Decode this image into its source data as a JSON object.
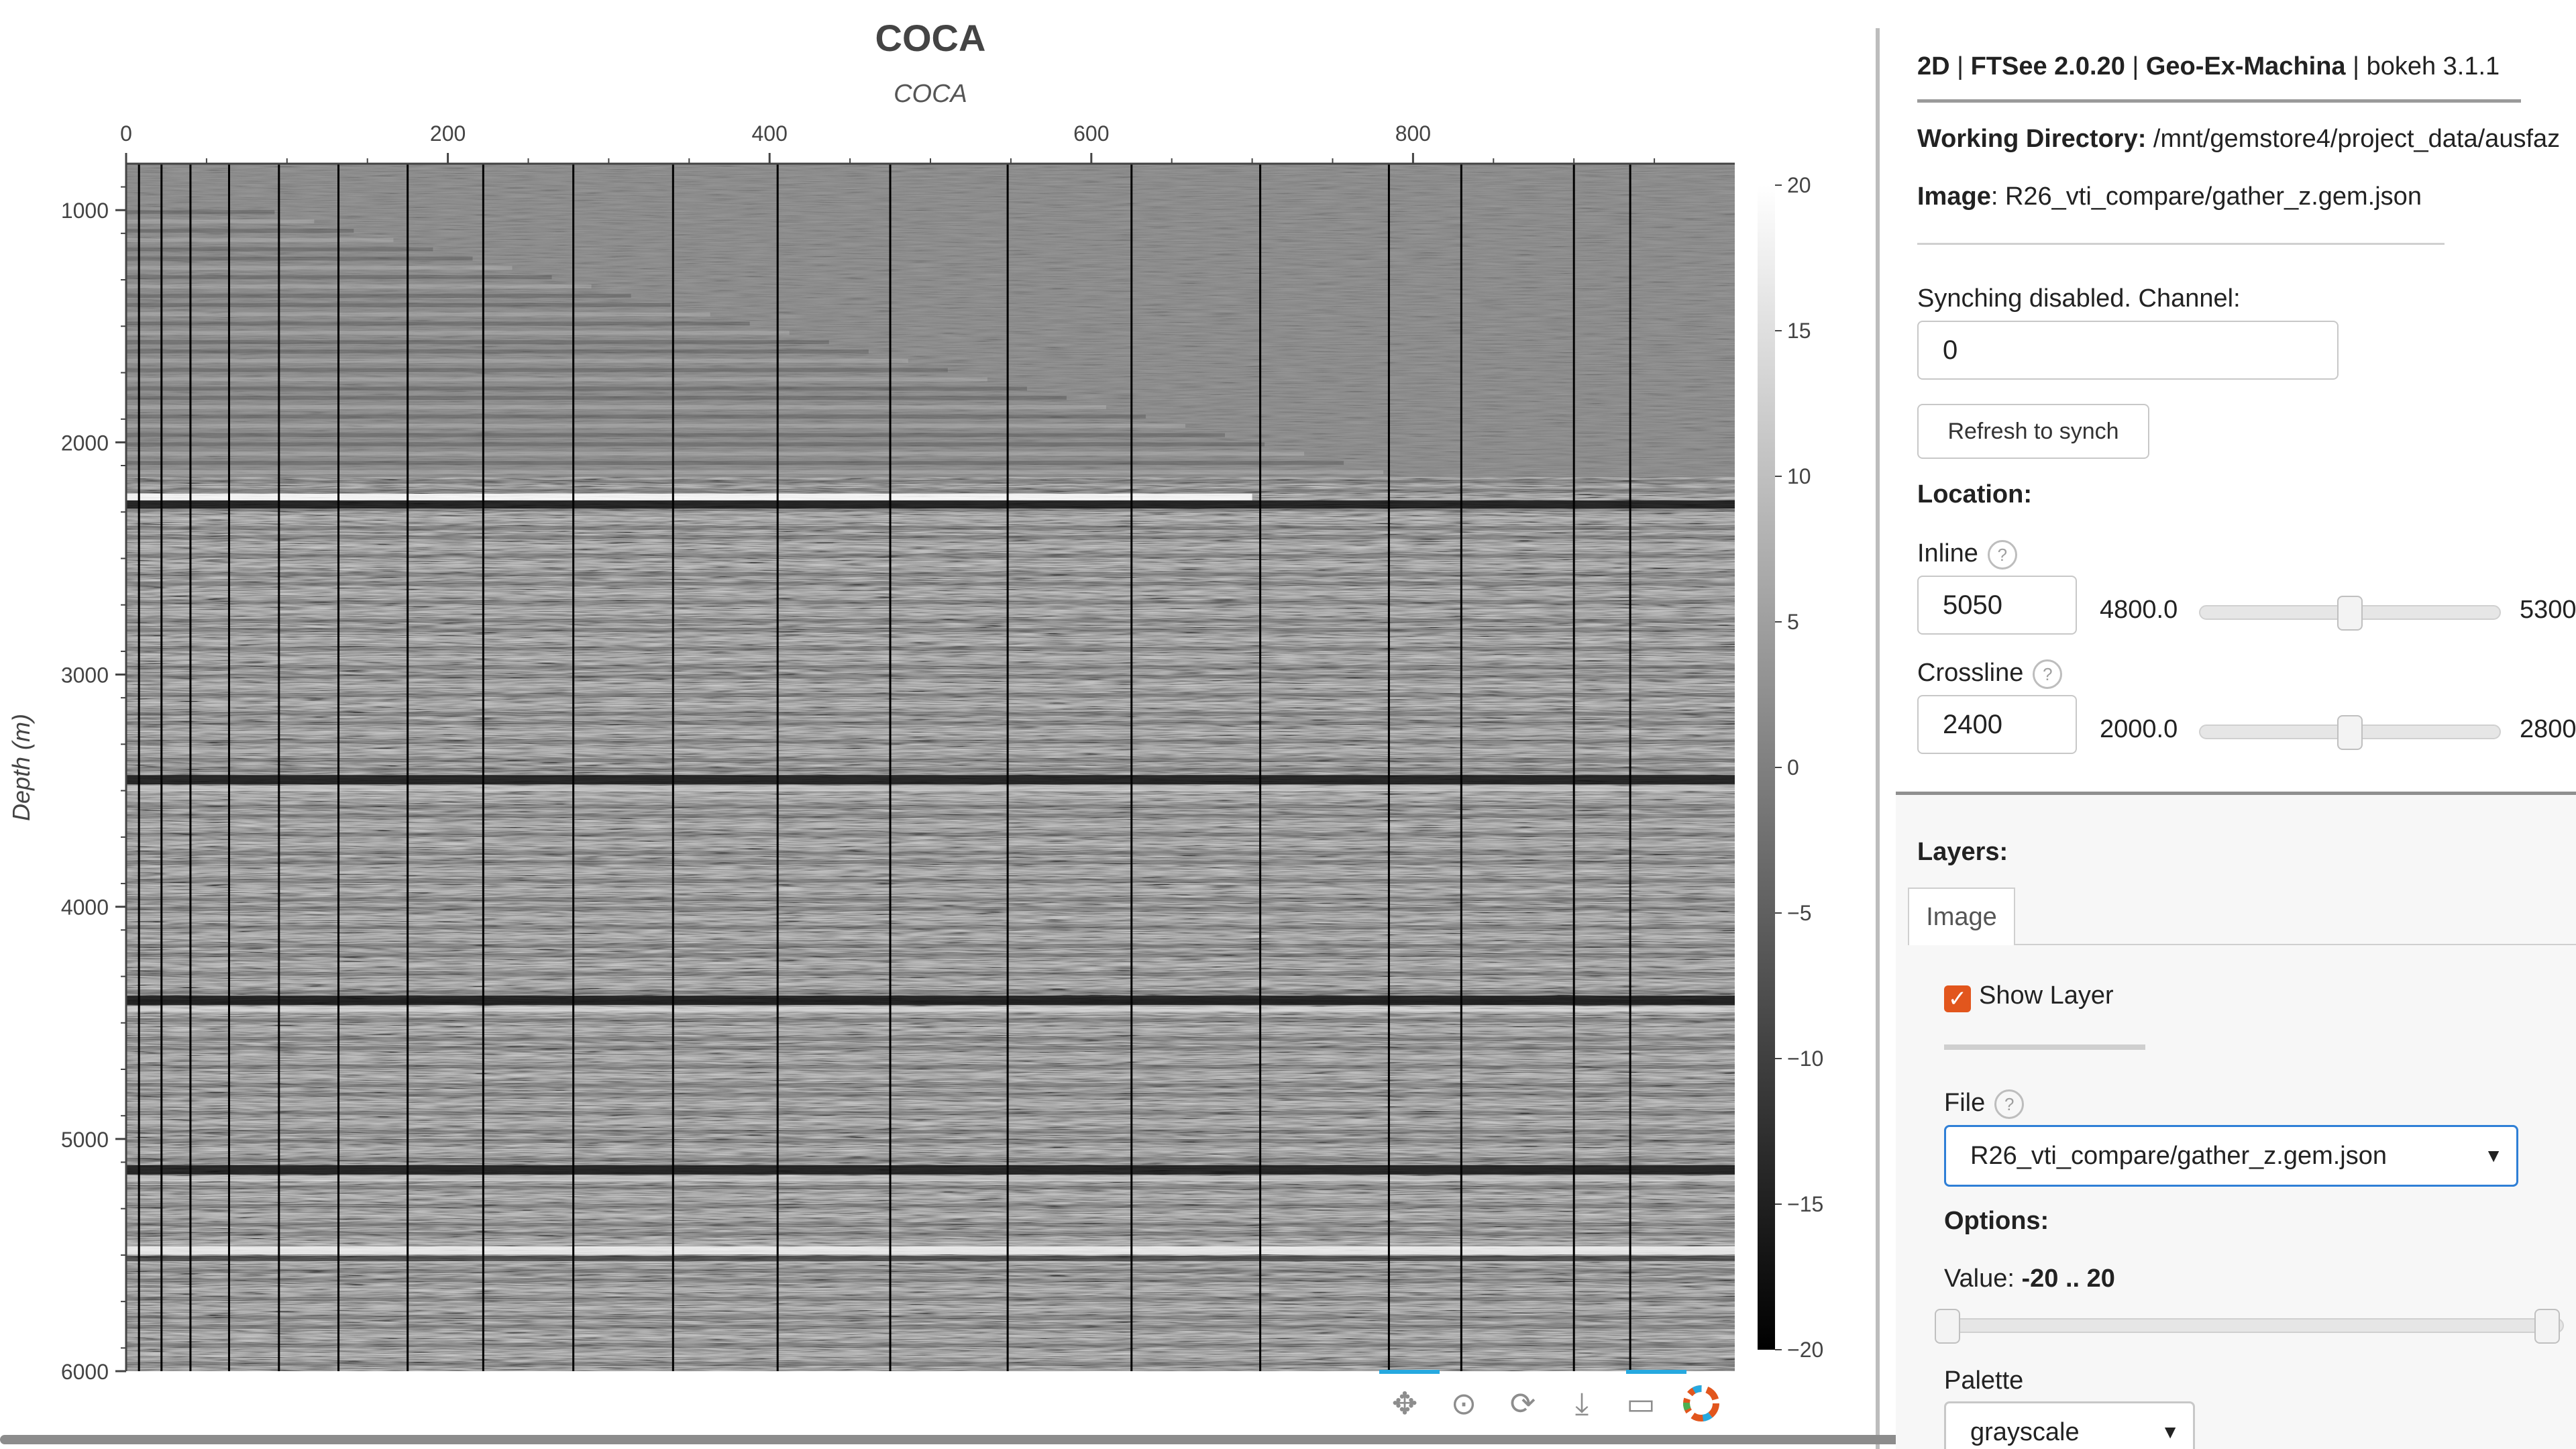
{
  "chart": {
    "title": "COCA",
    "subtitle": "COCA",
    "ylabel": "Depth (m)",
    "x_ticks": [
      "0",
      "200",
      "400",
      "600",
      "800"
    ],
    "y_ticks": [
      "1000",
      "2000",
      "3000",
      "4000",
      "5000",
      "6000"
    ],
    "colorbar_ticks": [
      "20",
      "15",
      "10",
      "5",
      "0",
      "−5",
      "−10",
      "−15",
      "−20"
    ]
  },
  "chart_data": {
    "type": "heatmap",
    "title": "COCA",
    "subtitle": "COCA",
    "xlabel": "",
    "ylabel": "Depth (m)",
    "xlim": [
      0,
      1000
    ],
    "ylim": [
      6000,
      800
    ],
    "x_ticks": [
      0,
      200,
      400,
      600,
      800
    ],
    "y_ticks": [
      1000,
      2000,
      3000,
      4000,
      5000,
      6000
    ],
    "color_range": [
      -20,
      20
    ],
    "colormap": "grayscale",
    "colorbar_ticks": [
      20,
      15,
      10,
      5,
      0,
      -5,
      -10,
      -15,
      -20
    ],
    "gather_boundaries_x": [
      0,
      8,
      22,
      40,
      64,
      95,
      132,
      175,
      222,
      278,
      340,
      405,
      475,
      548,
      625,
      705,
      785,
      830,
      900,
      935
    ],
    "strong_reflectors_depth": [
      {
        "depth": 2250,
        "polarity": "mixed"
      },
      {
        "depth": 3450,
        "polarity": "negative"
      },
      {
        "depth": 4400,
        "polarity": "negative"
      },
      {
        "depth": 5130,
        "polarity": "negative"
      },
      {
        "depth": 5480,
        "polarity": "positive"
      }
    ]
  },
  "toolbar": {
    "icons": [
      "pan-icon",
      "wheel-zoom-icon",
      "reset-icon",
      "save-icon",
      "hover-icon",
      "bokeh-logo-icon"
    ]
  },
  "panel": {
    "header_mode": "2D",
    "header_sep": "|",
    "header_app": "FTSee 2.0.20",
    "header_org": "Geo-Ex-Machina",
    "header_bokeh": "bokeh 3.1.1",
    "working_dir_label": "Working Directory:",
    "working_dir_value": "/mnt/gemstore4/project_data/ausfaz",
    "image_label": "Image",
    "image_value": ": R26_vti_compare/gather_z.gem.json",
    "synch_label": "Synching disabled. Channel:",
    "channel_value": "0",
    "refresh_label": "Refresh to synch",
    "location_label": "Location:",
    "inline_label": "Inline",
    "inline_value": "5050",
    "inline_min": "4800.0",
    "inline_max": "5300",
    "inline_fraction": 0.5,
    "crossline_label": "Crossline",
    "crossline_value": "2400",
    "crossline_min": "2000.0",
    "crossline_max": "2800",
    "crossline_fraction": 0.5,
    "help_glyph": "?",
    "layers_label": "Layers:",
    "tab_image": "Image",
    "show_layer_label": "Show Layer",
    "show_layer_checked": true,
    "file_label": "File",
    "file_value": "R26_vti_compare/gather_z.gem.json",
    "options_label": "Options:",
    "value_label": "Value: ",
    "value_range": "-20 .. 20",
    "palette_label": "Palette",
    "palette_value": "grayscale"
  },
  "colors": {
    "accent": "#e2561d",
    "focus": "#2f7fd6",
    "toolbar_active": "#26a9e0"
  }
}
